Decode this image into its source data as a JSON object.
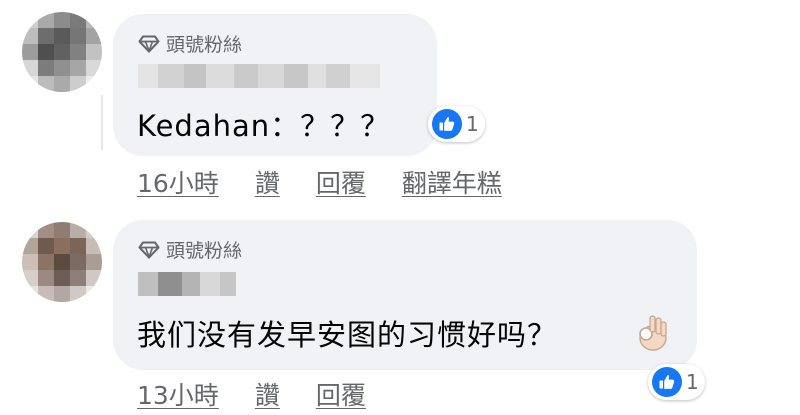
{
  "comments": [
    {
      "badge": "頭號粉絲",
      "text": "Kedahan：？？？",
      "reaction_count": "1",
      "time": "16小時",
      "like_label": "讚",
      "reply_label": "回覆",
      "translate_label": "翻譯年糕",
      "avatar_colors": [
        "#cfcfcf",
        "#a9a9a9",
        "#8c8c8c",
        "#7a7a7a",
        "#b8b8b8",
        "#bdbdbd",
        "#6d6d6d",
        "#5a5a5a",
        "#767676",
        "#a3a3a3",
        "#9c9c9c",
        "#4f4f4f",
        "#616161",
        "#818181",
        "#c2c2c2",
        "#d6d6d6",
        "#7c7c7c",
        "#909090",
        "#a6a6a6",
        "#d9d9d9",
        "#e6e6e6",
        "#bcbcbc",
        "#aaaaaa",
        "#cdcdcd",
        "#ececec"
      ]
    },
    {
      "badge": "頭號粉絲",
      "text": "我们没有发早安图的习惯好吗？",
      "reaction_count": "1",
      "time": "13小時",
      "like_label": "讚",
      "reply_label": "回覆",
      "avatar_colors": [
        "#d8d4d2",
        "#a18f84",
        "#8f7d72",
        "#b9aea7",
        "#d2cdca",
        "#b3a49b",
        "#6e5a4e",
        "#8b6e5c",
        "#7a6659",
        "#c7bdb7",
        "#cdbfb6",
        "#8c7465",
        "#5b4a40",
        "#7b6b62",
        "#a99d96",
        "#d6cfca",
        "#9a8a81",
        "#6b5d55",
        "#8e8079",
        "#cfc8c4",
        "#e7e4e2",
        "#c6bdb8",
        "#b2a8a3",
        "#d0c9c5",
        "#ece9e8"
      ]
    }
  ],
  "colors": {
    "bubble_bg": "#f0f2f5",
    "meta_text": "#65676b",
    "like_blue": "#1877f2"
  },
  "icons": [
    "diamond-icon",
    "thumbs-up-icon",
    "ok-hand-emoji-icon"
  ]
}
